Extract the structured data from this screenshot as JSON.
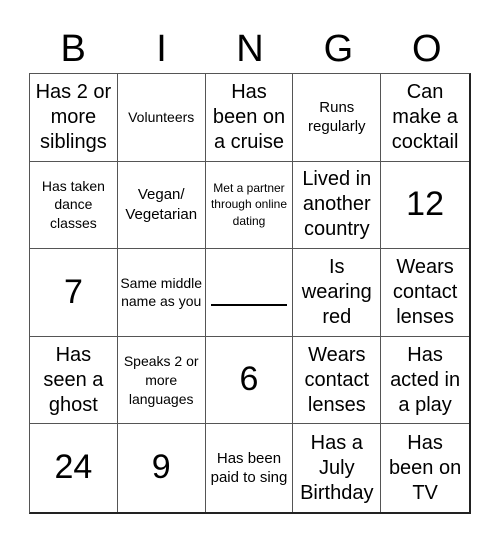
{
  "header": {
    "letters": [
      "B",
      "I",
      "N",
      "G",
      "O"
    ]
  },
  "cells": [
    {
      "text": "Has 2 or more siblings",
      "size": "l"
    },
    {
      "text": "Volunteers",
      "size": "s"
    },
    {
      "text": "Has been on a cruise",
      "size": "l"
    },
    {
      "text": "Runs regularly",
      "size": "m"
    },
    {
      "text": "Can make a cocktail",
      "size": "l"
    },
    {
      "text": "Has taken dance classes",
      "size": "s"
    },
    {
      "text": "Vegan/ Vegetarian",
      "size": "m"
    },
    {
      "text": "Met a partner through online dating",
      "size": "xs"
    },
    {
      "text": "Lived in another country",
      "size": "l"
    },
    {
      "text": "12",
      "size": "xl"
    },
    {
      "text": "7",
      "size": "xl"
    },
    {
      "text": "Same middle name as you",
      "size": "s"
    },
    {
      "text": "",
      "size": "blank"
    },
    {
      "text": "Is wearing red",
      "size": "l"
    },
    {
      "text": "Wears contact lenses",
      "size": "l"
    },
    {
      "text": "Has seen a ghost",
      "size": "l"
    },
    {
      "text": "Speaks 2 or more languages",
      "size": "s"
    },
    {
      "text": "6",
      "size": "xl"
    },
    {
      "text": "Wears contact lenses",
      "size": "l"
    },
    {
      "text": "Has acted in a play",
      "size": "l"
    },
    {
      "text": "24",
      "size": "xl"
    },
    {
      "text": "9",
      "size": "xl"
    },
    {
      "text": "Has been paid to sing",
      "size": "m"
    },
    {
      "text": "Has a July Birthday",
      "size": "l"
    },
    {
      "text": "Has been on TV",
      "size": "l"
    }
  ]
}
